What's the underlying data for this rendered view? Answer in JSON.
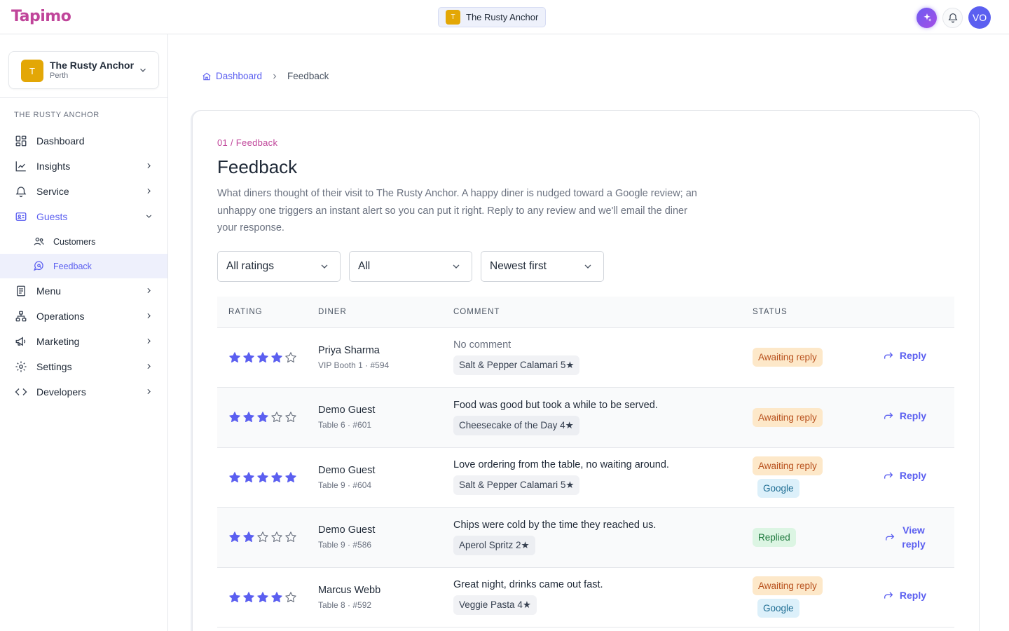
{
  "app": {
    "logo": "Tapimo"
  },
  "topbar": {
    "venue_initial": "T",
    "venue_name": "The Rusty Anchor",
    "avatar_initials": "VO"
  },
  "sidebar": {
    "venue_initial": "T",
    "venue_name": "The Rusty Anchor",
    "venue_city": "Perth",
    "section_label": "THE RUSTY ANCHOR",
    "items": [
      {
        "label": "Dashboard",
        "icon": "dashboard-icon"
      },
      {
        "label": "Insights",
        "icon": "chart-line-icon"
      },
      {
        "label": "Service",
        "icon": "bell-icon"
      },
      {
        "label": "Guests",
        "icon": "id-card-icon"
      },
      {
        "label": "Menu",
        "icon": "menu-book-icon"
      },
      {
        "label": "Operations",
        "icon": "hierarchy-icon"
      },
      {
        "label": "Marketing",
        "icon": "megaphone-icon"
      },
      {
        "label": "Settings",
        "icon": "gear-icon"
      },
      {
        "label": "Developers",
        "icon": "code-icon"
      }
    ],
    "sub_items": [
      {
        "label": "Customers",
        "icon": "users-icon"
      },
      {
        "label": "Feedback",
        "icon": "chat-search-icon"
      }
    ]
  },
  "breadcrumb": {
    "home": "Dashboard",
    "current": "Feedback"
  },
  "page": {
    "eyebrow": "01 / Feedback",
    "title": "Feedback",
    "description": "What diners thought of their visit to The Rusty Anchor. A happy diner is nudged toward a Google review; an unhappy one triggers an instant alert so you can put it right. Reply to any review and we'll email the diner your response."
  },
  "filters": {
    "rating": "All ratings",
    "status": "All",
    "sort": "Newest first"
  },
  "table": {
    "headers": {
      "rating": "RATING",
      "diner": "DINER",
      "comment": "COMMENT",
      "status": "STATUS"
    },
    "rows": [
      {
        "rating": 4,
        "diner": "Priya Sharma",
        "detail": "VIP Booth 1 · #594",
        "comment": "No comment",
        "dish": "Salt & Pepper Calamari 5★",
        "status": "Awaiting reply",
        "google": "",
        "action": "Reply"
      },
      {
        "rating": 3,
        "diner": "Demo Guest",
        "detail": "Table 6 · #601",
        "comment": "Food was good but took a while to be served.",
        "dish": "Cheesecake of the Day 4★",
        "status": "Awaiting reply",
        "google": "",
        "action": "Reply"
      },
      {
        "rating": 5,
        "diner": "Demo Guest",
        "detail": "Table 9 · #604",
        "comment": "Love ordering from the table, no waiting around.",
        "dish": "Salt & Pepper Calamari 5★",
        "status": "Awaiting reply",
        "google": "Google",
        "action": "Reply"
      },
      {
        "rating": 2,
        "diner": "Demo Guest",
        "detail": "Table 9 · #586",
        "comment": "Chips were cold by the time they reached us.",
        "dish": "Aperol Spritz 2★",
        "status": "Replied",
        "google": "",
        "action": "View reply"
      },
      {
        "rating": 4,
        "diner": "Marcus Webb",
        "detail": "Table 8 · #592",
        "comment": "Great night, drinks came out fast.",
        "dish": "Veggie Pasta 4★",
        "status": "Awaiting reply",
        "google": "Google",
        "action": "Reply"
      }
    ]
  },
  "colors": {
    "accent": "#5b5ff0",
    "brand": "#c0459a",
    "star": "#5b5ff0",
    "awaiting_bg": "#fde8c9",
    "replied_bg": "#dcf5e3",
    "google_bg": "#dcf0fa"
  }
}
